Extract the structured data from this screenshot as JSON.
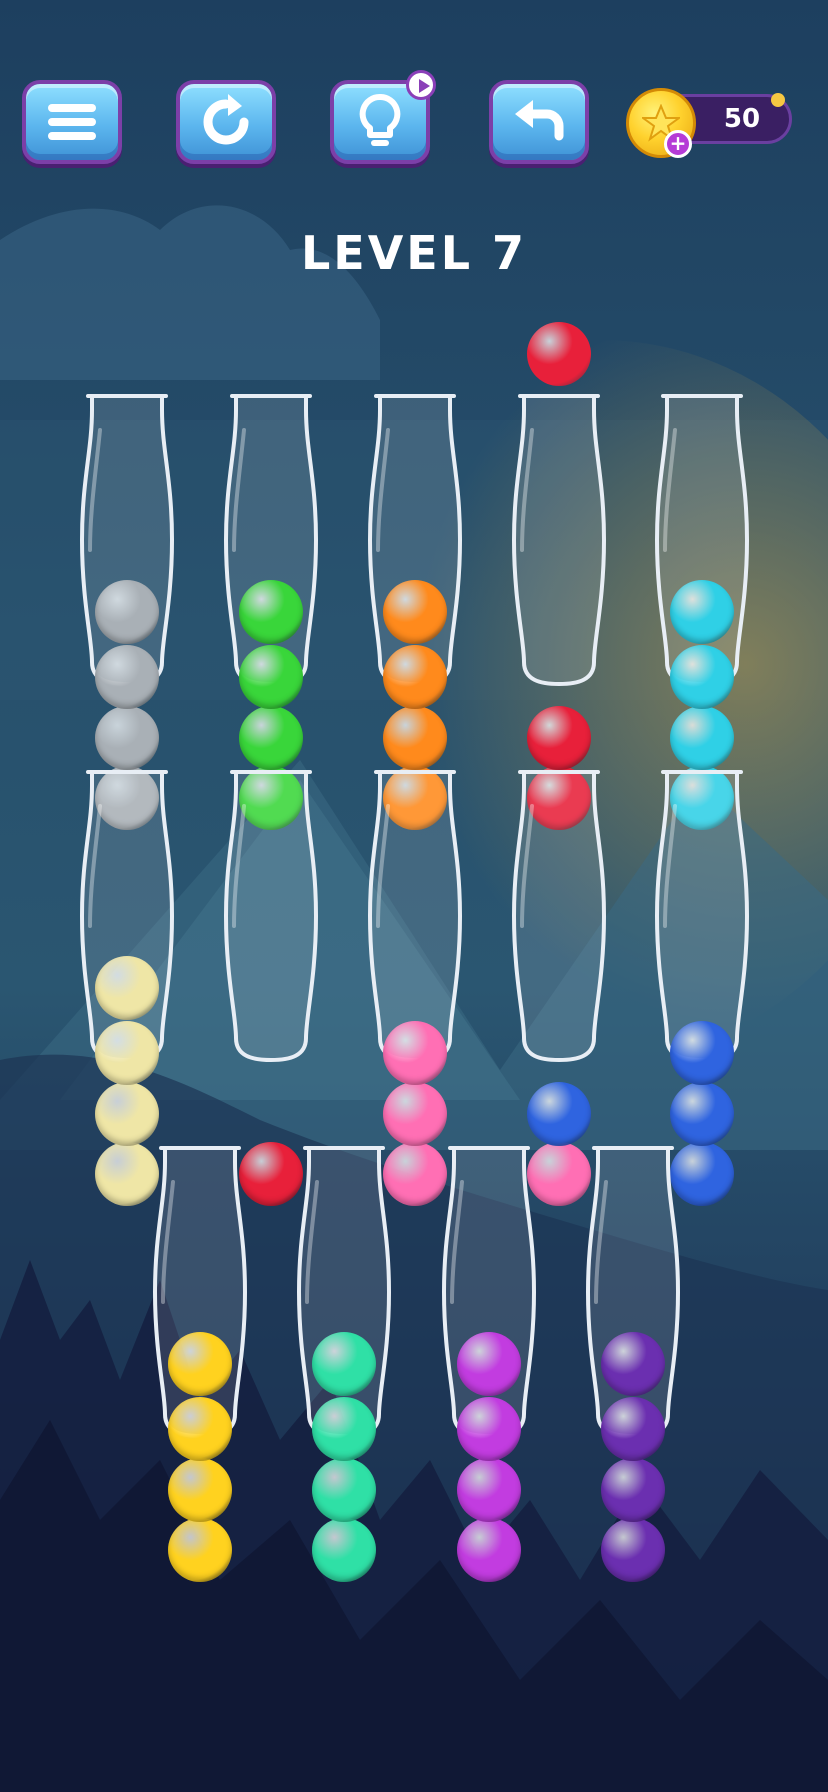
{
  "toolbar": {
    "menu": "menu",
    "restart": "restart",
    "hint": "hint",
    "undo": "undo"
  },
  "coins": {
    "count": "50"
  },
  "level": {
    "title": "LEVEL 7"
  },
  "colors": {
    "gray": "#a9b0b6",
    "green": "#39d63a",
    "orange": "#ff8a1c",
    "red": "#e8203a",
    "cyan": "#2fd0e6",
    "cream": "#efe6a6",
    "pink": "#ff6fb4",
    "blue": "#2f64e0",
    "yellow": "#ffd21f",
    "teal": "#2fe0a6",
    "magenta": "#c23ce0",
    "purple": "#6b2fb0"
  },
  "board": {
    "capacity": 4,
    "floating_ball": {
      "color": "red",
      "tube_index": 3
    },
    "rows": [
      [
        [
          "gray",
          "gray",
          "gray",
          "gray"
        ],
        [
          "green",
          "green",
          "green",
          "green"
        ],
        [
          "orange",
          "orange",
          "orange",
          "orange"
        ],
        [
          "red",
          "red"
        ],
        [
          "cyan",
          "cyan",
          "cyan",
          "cyan"
        ]
      ],
      [
        [
          "cream",
          "cream",
          "cream",
          "cream"
        ],
        [
          "red"
        ],
        [
          "pink",
          "pink",
          "pink"
        ],
        [
          "pink",
          "blue"
        ],
        [
          "blue",
          "blue",
          "blue"
        ]
      ],
      [
        [
          "yellow",
          "yellow",
          "yellow",
          "yellow"
        ],
        [
          "teal",
          "teal",
          "teal",
          "teal"
        ],
        [
          "magenta",
          "magenta",
          "magenta",
          "magenta"
        ],
        [
          "purple",
          "purple",
          "purple",
          "purple"
        ]
      ]
    ]
  }
}
